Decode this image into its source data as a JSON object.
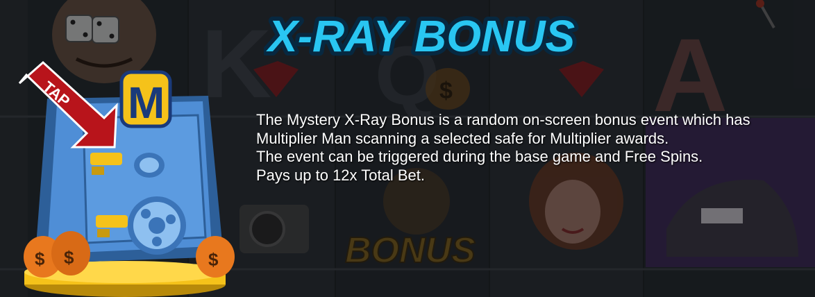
{
  "title": "X-RAY BONUS",
  "tap_label": "TAP",
  "safe_logo": "M",
  "reel_symbols": {
    "letter_k": "K",
    "letter_q": "Q",
    "letter_a": "A",
    "bonus_word": "BONUS"
  },
  "description": [
    "The Mystery X-Ray Bonus is a random on-screen bonus event which has",
    "Multiplier Man scanning a selected safe for Multiplier awards.",
    "The event can be triggered during the base game and Free Spins.",
    "Pays up to 12x Total Bet."
  ],
  "colors": {
    "title_fill": "#29c6f2",
    "title_outline": "#0a3a5a",
    "safe_blue": "#4f8ed6",
    "gold": "#f5c21a",
    "arrow_red": "#b8141b",
    "money_bag": "#e8781e"
  }
}
